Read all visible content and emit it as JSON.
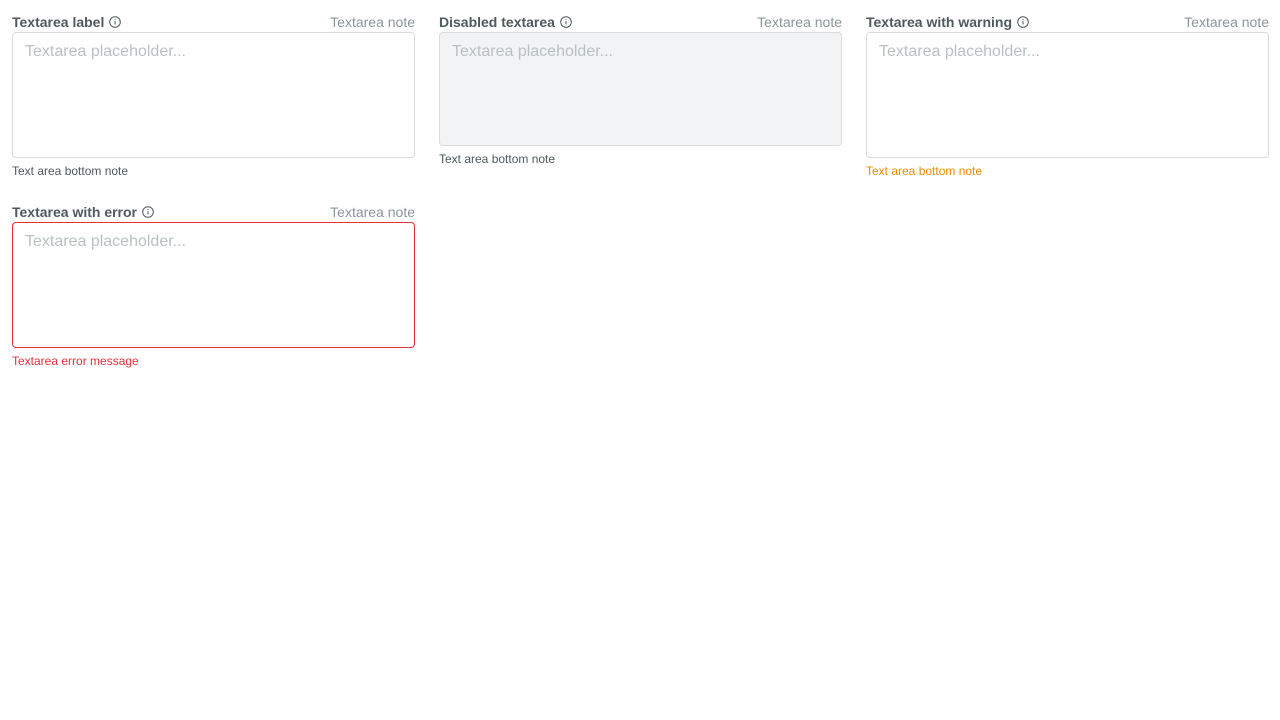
{
  "fields": [
    {
      "label": "Textarea label",
      "note": "Textarea note",
      "placeholder": "Textarea placeholder...",
      "bottom_note": "Text area bottom note"
    },
    {
      "label": "Disabled textarea",
      "note": "Textarea note",
      "placeholder": "Textarea placeholder...",
      "bottom_note": "Text area bottom note"
    },
    {
      "label": "Textarea with warning",
      "note": "Textarea note",
      "placeholder": "Textarea placeholder...",
      "bottom_note": "Text area bottom note"
    },
    {
      "label": "Textarea with error",
      "note": "Textarea note",
      "placeholder": "Textarea placeholder...",
      "bottom_note": "Textarea error message"
    }
  ],
  "colors": {
    "warning": "#ef8c00",
    "error": "#e3303c"
  }
}
